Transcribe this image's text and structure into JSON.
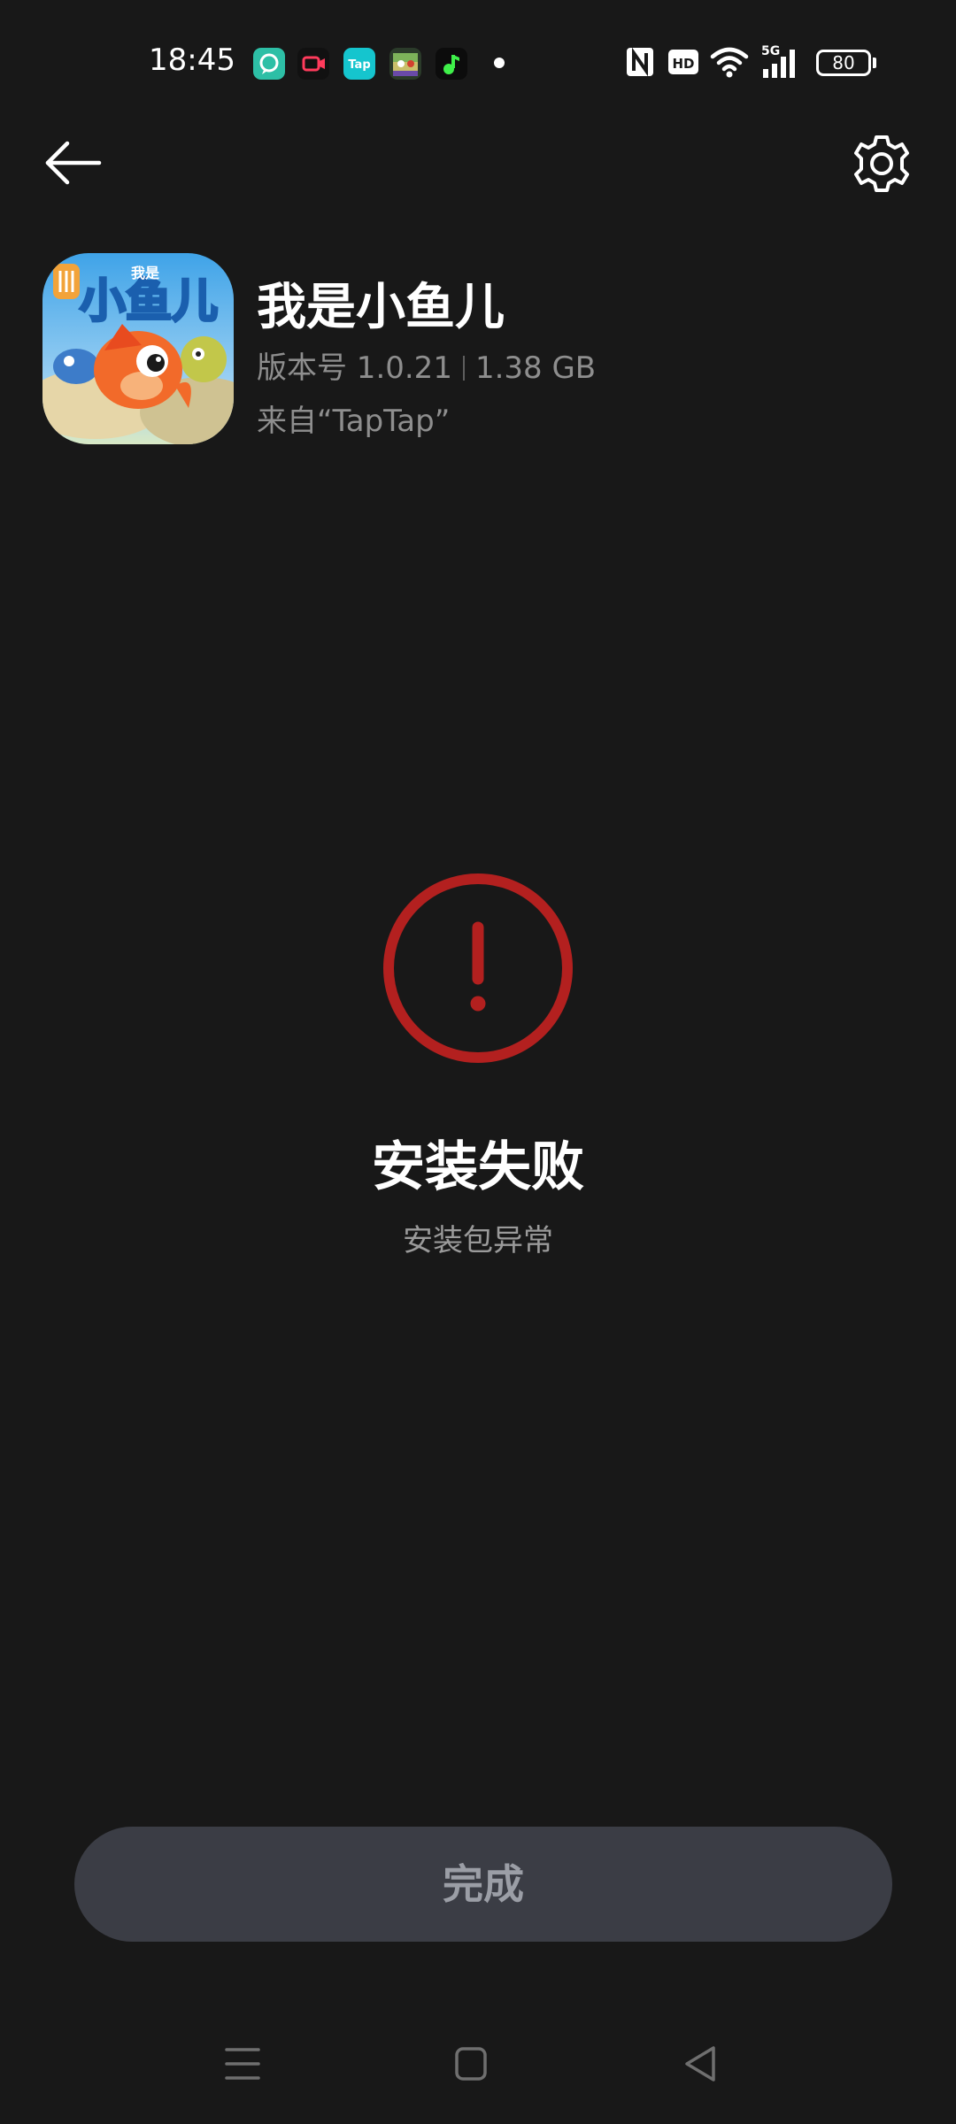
{
  "status_bar": {
    "time": "18:45",
    "battery": "80",
    "network": "5G",
    "hd_label": "HD",
    "tap_label": "Tap",
    "notification_icons": [
      "chat-bubble-icon",
      "screen-record-icon",
      "taptap-icon",
      "game-thumbnail-icon",
      "music-note-icon"
    ]
  },
  "toolbar": {
    "back_icon": "arrow-left-icon",
    "settings_icon": "gear-icon"
  },
  "app": {
    "name": "我是小鱼儿",
    "version": "版本号 1.0.21",
    "size": "1.38 GB",
    "source": "来自“TapTap”",
    "icon_text": "小鱼儿",
    "icon_badge": "我是"
  },
  "result": {
    "title": "安装失败",
    "subtitle": "安装包异常",
    "icon": "error-exclamation-icon",
    "accent_color": "#b3201f"
  },
  "actions": {
    "done_label": "完成"
  },
  "nav_bar": {
    "items": [
      "menu-icon",
      "home-icon",
      "back-triangle-icon"
    ]
  }
}
